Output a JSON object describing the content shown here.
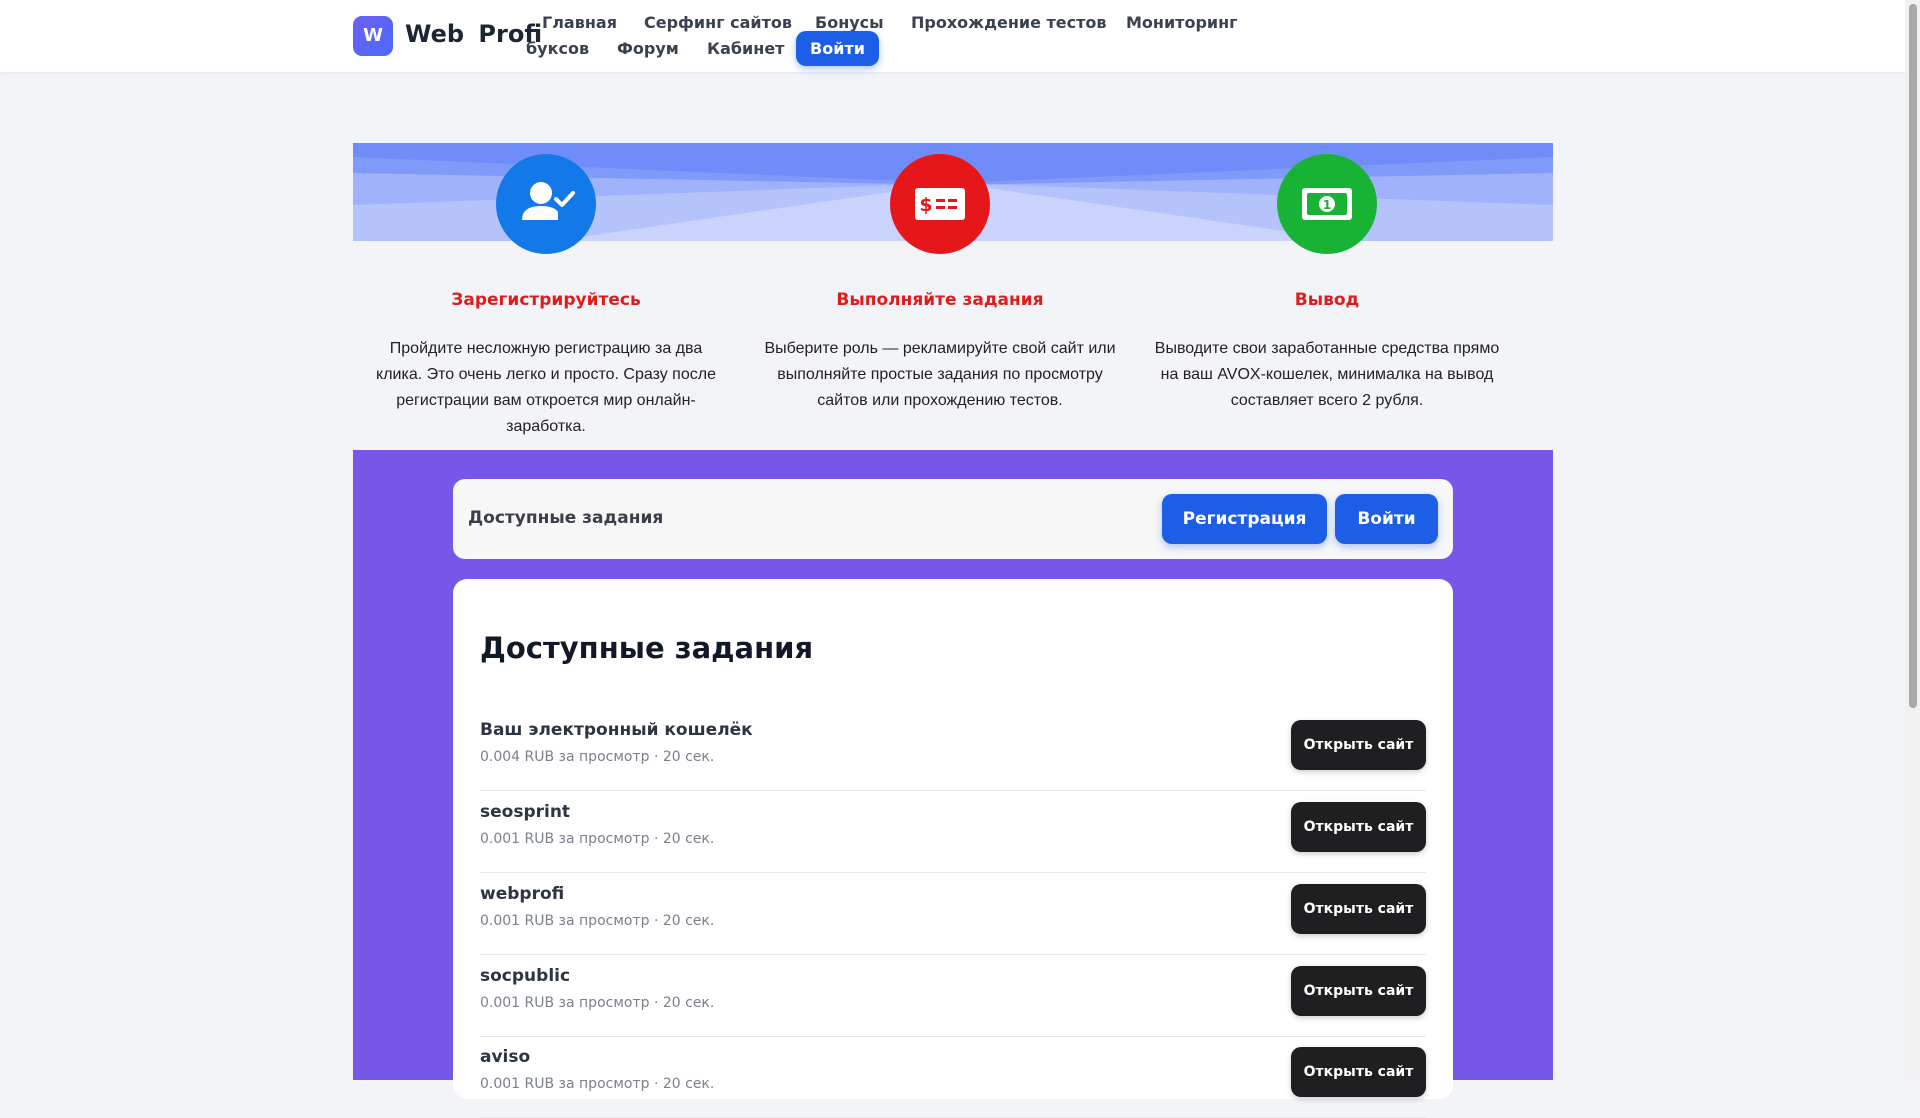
{
  "header": {
    "logo_letter": "W",
    "logo_text": "Web Profi",
    "nav": [
      "Главная",
      "Серфинг сайтов",
      "Бонусы",
      "Прохождение тестов",
      "Мониторинг",
      "буксов",
      "Форум",
      "Кабинет"
    ],
    "login_label": "Войти"
  },
  "hero": {
    "steps": [
      {
        "icon": "user-check-icon",
        "color": "#1479e8",
        "title": "Зарегистрируйтесь",
        "lines": [
          "Пройдите несложную регистрацию за два",
          "клика. Это очень легко и просто. Сразу после",
          "регистрации вам откроется мир онлайн-",
          "заработка."
        ]
      },
      {
        "icon": "money-card-icon",
        "color": "#e5171b",
        "title": "Выполняйте задания",
        "lines": [
          "Выберите роль — рекламируйте свой сайт или",
          "выполняйте простые задания по просмотру",
          "сайтов или прохождению тестов."
        ]
      },
      {
        "icon": "banknote-icon",
        "color": "#18b234",
        "title": "Вывод",
        "lines": [
          "Выводите свои заработанные средства прямо",
          "на ваш AVOX-кошелек, минималка на вывод",
          "составляет всего 2 рубля."
        ]
      }
    ]
  },
  "topbar": {
    "title": "Доступные задания",
    "register_label": "Регистрация",
    "login_label": "Войти"
  },
  "tasks": {
    "heading": "Доступные задания",
    "button_label": "Открыть сайт",
    "items": [
      {
        "name": "Ваш электронный кошелёк",
        "meta": "0.004 RUB за просмотр · 20 сек."
      },
      {
        "name": "seosprint",
        "meta": "0.001 RUB за просмотр · 20 сек."
      },
      {
        "name": "webprofi",
        "meta": "0.001 RUB за просмотр · 20 сек."
      },
      {
        "name": "socpublic",
        "meta": "0.001 RUB за просмотр · 20 сек."
      },
      {
        "name": "aviso",
        "meta": "0.001 RUB за просмотр · 20 сек."
      }
    ]
  },
  "colors": {
    "accent": "#1d5ee6",
    "purple": "#7657e8",
    "title_red": "#e01b1b"
  }
}
